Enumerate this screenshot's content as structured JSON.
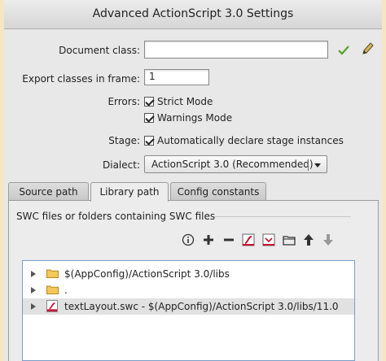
{
  "window": {
    "title": "Advanced ActionScript 3.0 Settings"
  },
  "document_class": {
    "label": "Document class:",
    "value": ""
  },
  "export_frame": {
    "label": "Export classes in frame:",
    "value": "1"
  },
  "errors": {
    "label": "Errors:",
    "strict_mode": "Strict Mode",
    "warnings_mode": "Warnings Mode"
  },
  "stage": {
    "label": "Stage:",
    "auto_declare": "Automatically declare stage instances"
  },
  "dialect": {
    "label": "Dialect:",
    "value": "ActionScript 3.0 (Recommended)"
  },
  "tabs": [
    {
      "label": "Source path"
    },
    {
      "label": "Library path"
    },
    {
      "label": "Config constants"
    }
  ],
  "library": {
    "section_label": "SWC files or folders containing SWC files",
    "items": [
      {
        "icon": "folder-icon",
        "text": "$(AppConfig)/ActionScript 3.0/libs"
      },
      {
        "icon": "folder-icon",
        "text": "."
      },
      {
        "icon": "swc-file-icon",
        "text": "textLayout.swc - $(AppConfig)/ActionScript 3.0/libs/11.0"
      }
    ]
  },
  "colors": {
    "check": "#5aa02c",
    "flash_red": "#c8102e",
    "list_border": "#7a9cc6"
  }
}
